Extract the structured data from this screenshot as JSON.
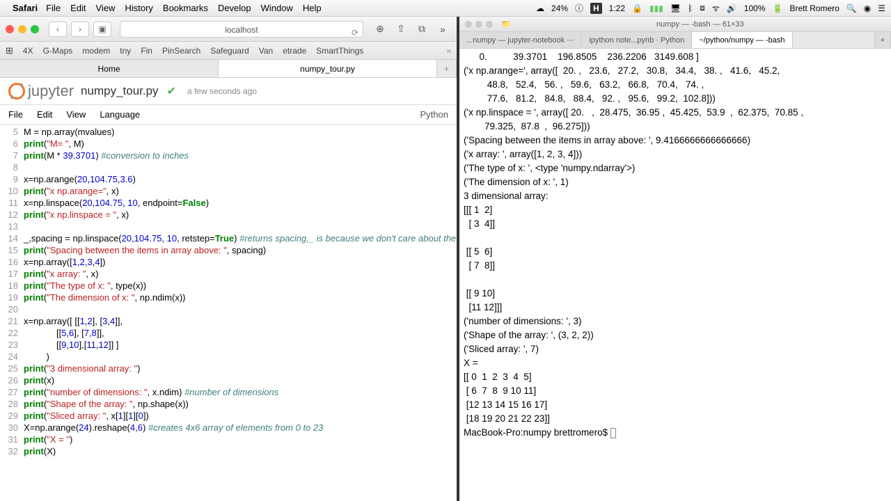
{
  "menubar": {
    "app": "Safari",
    "items": [
      "File",
      "Edit",
      "View",
      "History",
      "Bookmarks",
      "Develop",
      "Window",
      "Help"
    ],
    "zoom": "24%",
    "time_badge": "H",
    "time": "1:22",
    "battery": "100%",
    "user": "Brett Romero"
  },
  "browser": {
    "url": "localhost",
    "favorites": [
      "4X",
      "G-Maps",
      "modem",
      "tny",
      "Fin",
      "PinSearch",
      "Safeguard",
      "Van",
      "etrade",
      "SmartThings"
    ],
    "tabs": [
      {
        "label": "Home",
        "active": false
      },
      {
        "label": "numpy_tour.py",
        "active": true
      }
    ]
  },
  "jupyter": {
    "logo_text": "jupyter",
    "nb_name": "numpy_tour.py",
    "saved_ago": "a few seconds ago",
    "menus": [
      "File",
      "Edit",
      "View",
      "Language"
    ],
    "kernel": "Python"
  },
  "code": [
    {
      "n": 5,
      "html": "M = np.array(mvalues)"
    },
    {
      "n": 6,
      "html": "<span class='kw'>print</span>(<span class='str'>\"M= \"</span>, M)"
    },
    {
      "n": 7,
      "html": "<span class='kw'>print</span>(M * <span class='num'>39.3701</span>) <span class='com'>#conversion to inches</span>"
    },
    {
      "n": 8,
      "html": ""
    },
    {
      "n": 9,
      "html": "x=np.arange(<span class='num'>20</span>,<span class='num'>104.75</span>,<span class='num'>3.6</span>)"
    },
    {
      "n": 10,
      "html": "<span class='kw'>print</span>(<span class='str'>\"x np.arange=\"</span>, x)"
    },
    {
      "n": 11,
      "html": "x=np.linspace(<span class='num'>20</span>,<span class='num'>104.75</span>, <span class='num'>10</span>, endpoint=<span class='bool'>False</span>)"
    },
    {
      "n": 12,
      "html": "<span class='kw'>print</span>(<span class='str'>\"x np.linspace = \"</span>, x)"
    },
    {
      "n": 13,
      "html": ""
    },
    {
      "n": 14,
      "html": "_,spacing = np.linspace(<span class='num'>20</span>,<span class='num'>104.75</span>, <span class='num'>10</span>, retstep=<span class='bool'>True</span>) <span class='com'>#returns spacing,_ is because we don't care about the actual array now</span>"
    },
    {
      "n": 15,
      "html": "<span class='kw'>print</span>(<span class='str'>\"Spacing between the items in array above: \"</span>, spacing)"
    },
    {
      "n": 16,
      "html": "x=np.array([<span class='num'>1</span>,<span class='num'>2</span>,<span class='num'>3</span>,<span class='num'>4</span>])"
    },
    {
      "n": 17,
      "html": "<span class='kw'>print</span>(<span class='str'>\"x array: \"</span>, x)"
    },
    {
      "n": 18,
      "html": "<span class='kw'>print</span>(<span class='str'>\"The type of x: \"</span>, type(x))"
    },
    {
      "n": 19,
      "html": "<span class='kw'>print</span>(<span class='str'>\"The dimension of x: \"</span>, np.ndim(x))"
    },
    {
      "n": 20,
      "html": ""
    },
    {
      "n": 21,
      "html": "x=np.array([ [[<span class='num'>1</span>,<span class='num'>2</span>], [<span class='num'>3</span>,<span class='num'>4</span>]],"
    },
    {
      "n": 22,
      "html": "             [[<span class='num'>5</span>,<span class='num'>6</span>], [<span class='num'>7</span>,<span class='num'>8</span>]],"
    },
    {
      "n": 23,
      "html": "             [[<span class='num'>9</span>,<span class='num'>10</span>],[<span class='num'>11</span>,<span class='num'>12</span>]] ]"
    },
    {
      "n": 24,
      "html": "         )"
    },
    {
      "n": 25,
      "html": "<span class='kw'>print</span>(<span class='str'>\"3 dimensional array: \"</span>)"
    },
    {
      "n": 26,
      "html": "<span class='kw'>print</span>(x)"
    },
    {
      "n": 27,
      "html": "<span class='kw'>print</span>(<span class='str'>\"number of dimensions: \"</span>, x.ndim) <span class='com'>#number of dimensions</span>"
    },
    {
      "n": 28,
      "html": "<span class='kw'>print</span>(<span class='str'>\"Shape of the array: \"</span>, np.shape(x))"
    },
    {
      "n": 29,
      "html": "<span class='kw'>print</span>(<span class='str'>\"Sliced array: \"</span>, x[<span class='num'>1</span>][<span class='num'>1</span>][<span class='num'>0</span>])"
    },
    {
      "n": 30,
      "html": "X=np.arange(<span class='num'>24</span>).reshape(<span class='num'>4</span>,<span class='num'>6</span>) <span class='com'>#creates 4x6 array of elements from 0 to 23</span>"
    },
    {
      "n": 31,
      "html": "<span class='kw'>print</span>(<span class='str'>\"X = \"</span>)"
    },
    {
      "n": 32,
      "html": "<span class='kw'>print</span>(X)"
    }
  ],
  "terminal": {
    "title": "numpy — -bash — 61×33",
    "tabs": [
      {
        "label": "...numpy — jupyter-notebook ⋯",
        "active": false
      },
      {
        "label": "ipython note...pynb · Python",
        "active": false
      },
      {
        "label": "~/python/numpy — -bash",
        "active": true
      }
    ],
    "output": "      0.          39.3701    196.8505    236.2206   3149.608 ]\n('x np.arange=', array([  20. ,   23.6,   27.2,   30.8,   34.4,   38. ,   41.6,   45.2,\n         48.8,   52.4,   56. ,   59.6,   63.2,   66.8,   70.4,   74. ,\n         77.6,   81.2,   84.8,   88.4,   92. ,   95.6,   99.2,  102.8]))\n('x np.linspace = ', array([ 20.   ,  28.475,  36.95 ,  45.425,  53.9  ,  62.375,  70.85 ,\n        79.325,  87.8  ,  96.275]))\n('Spacing between the items in array above: ', 9.4166666666666666)\n('x array: ', array([1, 2, 3, 4]))\n('The type of x: ', <type 'numpy.ndarray'>)\n('The dimension of x: ', 1)\n3 dimensional array: \n[[[ 1  2]\n  [ 3  4]]\n\n [[ 5  6]\n  [ 7  8]]\n\n [[ 9 10]\n  [11 12]]]\n('number of dimensions: ', 3)\n('Shape of the array: ', (3, 2, 2))\n('Sliced array: ', 7)\nX = \n[[ 0  1  2  3  4  5]\n [ 6  7  8  9 10 11]\n [12 13 14 15 16 17]\n [18 19 20 21 22 23]]\nMacBook-Pro:numpy brettromero$ "
  }
}
